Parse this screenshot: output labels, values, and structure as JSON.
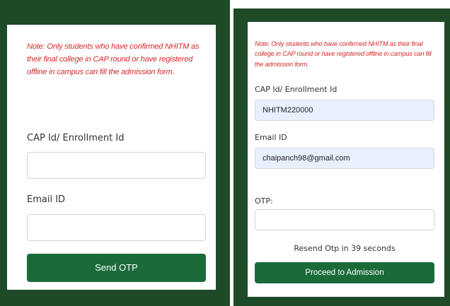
{
  "left_form": {
    "note": "Note: Only students who have confirmed NHITM as their final college in CAP round or have registered offline in campus can fill the admission form.",
    "cap_label": "CAP Id/ Enrollment Id",
    "cap_value": "",
    "email_label": "Email ID",
    "email_value": "",
    "send_otp_label": "Send OTP"
  },
  "right_form": {
    "note": "Note: Only students who have confirmed NHITM as their final college in CAP round or have registered offline in campus can fill the admission form.",
    "cap_label": "CAP Id/ Enrollment Id",
    "cap_value": "NHITM220000",
    "email_label": "Email ID",
    "email_value": "chaipanch98@gmail.com",
    "otp_label": "OTP:",
    "otp_value": "",
    "resend_text": "Resend Otp in 39 seconds",
    "proceed_label": "Proceed to Admission"
  },
  "colors": {
    "background_panel": "#1f4a27",
    "button": "#1b6b3a",
    "note_text": "#d92a2a",
    "filled_input": "#e8f0fe"
  }
}
